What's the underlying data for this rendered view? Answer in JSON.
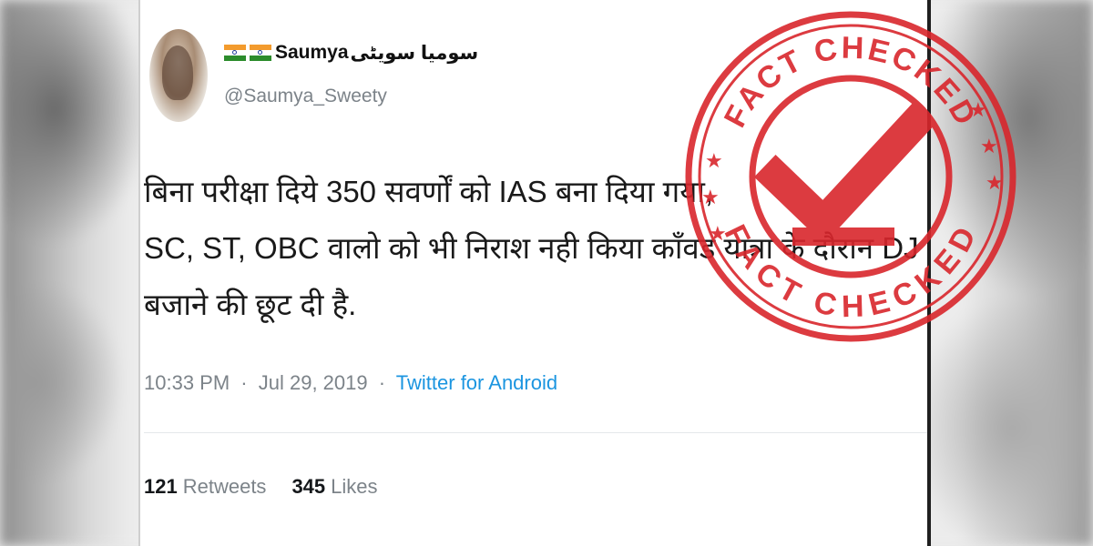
{
  "tweet": {
    "display_name": "Saumya",
    "display_name_urdu": "سومیا سویٹی",
    "handle": "@Saumya_Sweety",
    "text_lines": [
      "बिना परीक्षा दिये 350 सवर्णों को IAS बना दिया गया,",
      "SC, ST, OBC वालो को भी निराश नही किया काँवड यात्रा के दौरान DJ",
      "बजाने की छूट दी है."
    ],
    "time": "10:33 PM",
    "date": "Jul 29, 2019",
    "separator": "·",
    "source": "Twitter for Android",
    "retweets_count": "121",
    "retweets_label": "Retweets",
    "likes_count": "345",
    "likes_label": "Likes"
  },
  "stamp": {
    "top_text": "FACT CHECKED",
    "bottom_text": "FACT CHECKED",
    "color": "#d9262c",
    "icon": "check-mark-icon"
  },
  "colors": {
    "link_blue": "#1b95e0",
    "meta_gray": "#7c8389",
    "stamp_red": "#d9262c"
  }
}
